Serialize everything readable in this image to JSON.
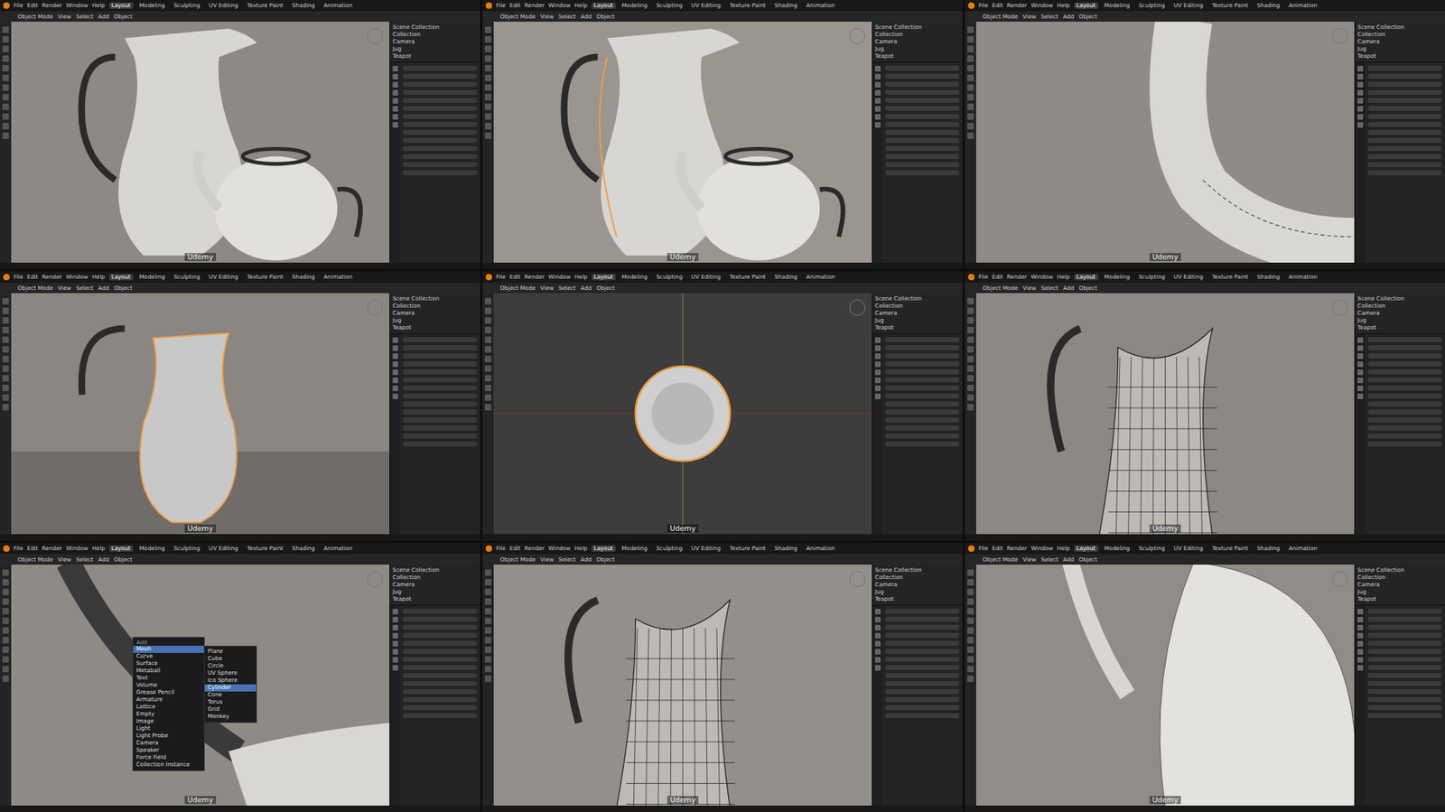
{
  "menu": [
    "File",
    "Edit",
    "Render",
    "Window",
    "Help"
  ],
  "workspaces": [
    {
      "label": "Layout",
      "selected": true
    },
    {
      "label": "Modeling",
      "selected": false
    },
    {
      "label": "Sculpting",
      "selected": false
    },
    {
      "label": "UV Editing",
      "selected": false
    },
    {
      "label": "Texture Paint",
      "selected": false
    },
    {
      "label": "Shading",
      "selected": false
    },
    {
      "label": "Animation",
      "selected": false
    }
  ],
  "header": [
    "Object Mode",
    "View",
    "Select",
    "Add",
    "Object"
  ],
  "outliner": [
    "Scene Collection",
    "Collection",
    "Camera",
    "Jug",
    "Teapot"
  ],
  "watermark": "Udemy",
  "tiles": [
    {
      "scene": "jug-teapot",
      "color": "#8d8984"
    },
    {
      "scene": "jug-outline",
      "color": "#9a958f"
    },
    {
      "scene": "closeup",
      "color": "#8f8b86"
    },
    {
      "scene": "jug-solid",
      "color": "#8a8681"
    },
    {
      "scene": "top-view",
      "color": "#3d3d3d"
    },
    {
      "scene": "jug-wire",
      "color": "#8c8883"
    },
    {
      "scene": "handle-menu",
      "color": "#8e8a85"
    },
    {
      "scene": "handle-wire",
      "color": "#938f8a"
    },
    {
      "scene": "spout",
      "color": "#908c87"
    }
  ],
  "add_menu": {
    "title": "Add",
    "items": [
      {
        "label": "Mesh",
        "selected": true
      },
      {
        "label": "Curve",
        "selected": false
      },
      {
        "label": "Surface",
        "selected": false
      },
      {
        "label": "Metaball",
        "selected": false
      },
      {
        "label": "Text",
        "selected": false
      },
      {
        "label": "Volume",
        "selected": false
      },
      {
        "label": "Grease Pencil",
        "selected": false
      },
      {
        "label": "Armature",
        "selected": false
      },
      {
        "label": "Lattice",
        "selected": false
      },
      {
        "label": "Empty",
        "selected": false
      },
      {
        "label": "Image",
        "selected": false
      },
      {
        "label": "Light",
        "selected": false
      },
      {
        "label": "Light Probe",
        "selected": false
      },
      {
        "label": "Camera",
        "selected": false
      },
      {
        "label": "Speaker",
        "selected": false
      },
      {
        "label": "Force Field",
        "selected": false
      },
      {
        "label": "Collection Instance",
        "selected": false
      }
    ],
    "submenu": [
      {
        "label": "Plane",
        "selected": false
      },
      {
        "label": "Cube",
        "selected": false
      },
      {
        "label": "Circle",
        "selected": false
      },
      {
        "label": "UV Sphere",
        "selected": false
      },
      {
        "label": "Ico Sphere",
        "selected": false
      },
      {
        "label": "Cylinder",
        "selected": true
      },
      {
        "label": "Cone",
        "selected": false
      },
      {
        "label": "Torus",
        "selected": false
      },
      {
        "label": "Grid",
        "selected": false
      },
      {
        "label": "Monkey",
        "selected": false
      }
    ]
  }
}
